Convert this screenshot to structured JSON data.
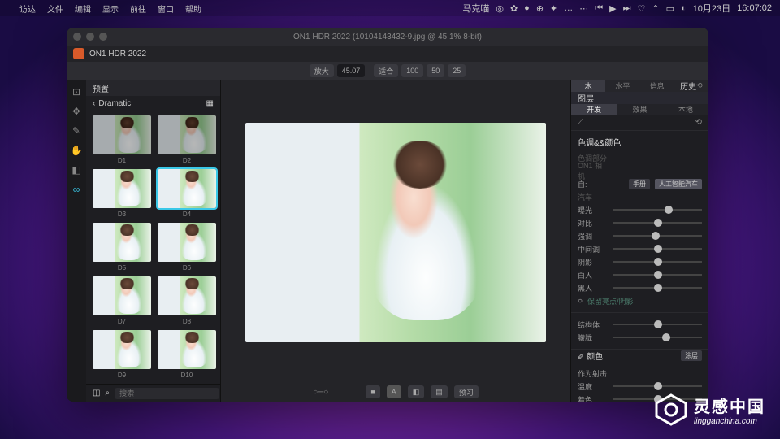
{
  "menubar": {
    "apple": "",
    "items": [
      "访达",
      "文件",
      "编辑",
      "显示",
      "前往",
      "窗口",
      "帮助"
    ],
    "user": "马克喵",
    "date": "10月23日",
    "time": "16:07:02"
  },
  "window": {
    "title": "ON1 HDR 2022 (10104143432-9.jpg @ 45.1% 8-bit)",
    "app_name": "ON1 HDR 2022"
  },
  "toolbar": {
    "zoom_label": "放大",
    "zoom_value": "45.07",
    "fit_label": "适合",
    "fit_100": "100",
    "fit_50": "50",
    "fit_25": "25"
  },
  "presets": {
    "header": "预置",
    "crumb": "Dramatic",
    "items": [
      {
        "label": "D1"
      },
      {
        "label": "D2"
      },
      {
        "label": "D3"
      },
      {
        "label": "D4",
        "sel": true
      },
      {
        "label": "D5"
      },
      {
        "label": "D6"
      },
      {
        "label": "D7"
      },
      {
        "label": "D8"
      },
      {
        "label": "D9"
      },
      {
        "label": "D10"
      }
    ],
    "search_placeholder": "搜索"
  },
  "right": {
    "top_tabs": [
      "木",
      "水平",
      "信息",
      "历史"
    ],
    "layers_label": "图层",
    "sub_tabs": [
      "开发",
      "效果",
      "本地"
    ],
    "tone_title": "色调&&颜色",
    "dim1": "色调部分",
    "dim2": "ON1 相机",
    "auto_label": "自:",
    "auto_mode1": "手册",
    "auto_mode2": "人工智能汽车",
    "dim3": "汽车",
    "sliders": [
      {
        "name": "曝光",
        "pos": 62
      },
      {
        "name": "对比",
        "pos": 50
      },
      {
        "name": "强调",
        "pos": 48
      },
      {
        "name": "中间调",
        "pos": 50
      },
      {
        "name": "阴影",
        "pos": 50
      },
      {
        "name": "白人",
        "pos": 50
      },
      {
        "name": "黑人",
        "pos": 50
      }
    ],
    "protect": "保留亮点/阴影",
    "sliders2": [
      {
        "name": "结构体",
        "pos": 50
      },
      {
        "name": "朦胧",
        "pos": 60
      }
    ],
    "color_label": "颜色:",
    "apply_btn": "涂层",
    "as_label": "作为射击",
    "sliders3": [
      {
        "name": "温度",
        "pos": 50
      },
      {
        "name": "着色",
        "pos": 50
      }
    ]
  },
  "bottom": {
    "preview": "预习"
  },
  "watermark": {
    "brand": "灵感中国",
    "url": "lingganchina.com"
  }
}
